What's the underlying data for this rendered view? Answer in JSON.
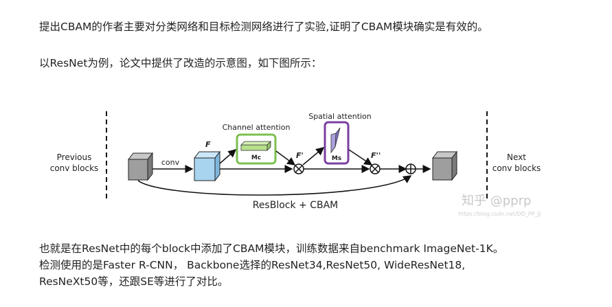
{
  "article": {
    "paragraph1": "提出CBAM的作者主要对分类网络和目标检测网络进行了实验,证明了CBAM模块确实是有效的。",
    "paragraph2": "以ResNet为例，论文中提供了改造的示意图，如下图所示：",
    "paragraph3_lines": [
      "也就是在ResNet中的每个block中添加了CBAM模块，训练数据来自benchmark ImageNet-1K。",
      "检测使用的是Faster R-CNN， Backbone选择的ResNet34,ResNet50, WideResNet18,",
      "ResNeXt50等，还跟SE等进行了对比。"
    ]
  },
  "figure": {
    "previous_label": [
      "Previous",
      "conv blocks"
    ],
    "next_label": [
      "Next",
      "conv blocks"
    ],
    "conv_label": "conv",
    "f_label": "F",
    "f_prime_label": "F'",
    "f_double_prime_label": "F''",
    "channel_attention_label": "Channel attention",
    "spatial_attention_label": "Spatial attention",
    "mc_label": "Mc",
    "ms_label": "Ms",
    "caption": "ResBlock + CBAM",
    "colors": {
      "channel_box": "#7cbf4f",
      "spatial_box": "#7a3fa0",
      "feature_cube": "#a8d4f0",
      "gray_cube": "#9e9e9e",
      "channel_bar": "#b8e08c",
      "spatial_bar": "#7c70c4"
    }
  },
  "watermark": {
    "text": "知乎 @pprp",
    "url_text": "https://blog.csdn.net/DD_PP_JJ"
  }
}
